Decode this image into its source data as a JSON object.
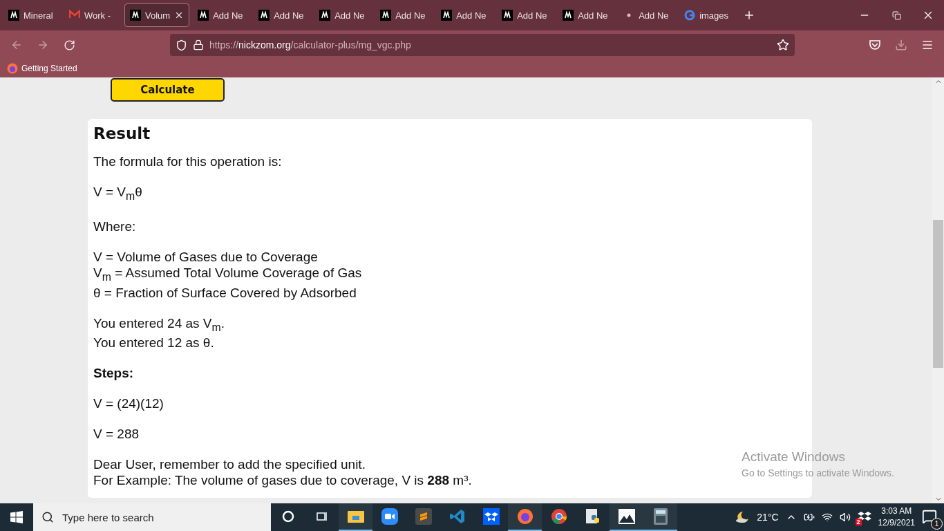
{
  "tabs": [
    {
      "label": "Mineral",
      "kind": "site",
      "selected": false
    },
    {
      "label": "Work -",
      "kind": "mail",
      "selected": false
    },
    {
      "label": "Volum",
      "kind": "site",
      "selected": true
    },
    {
      "label": "Add Ne",
      "kind": "site",
      "selected": false
    },
    {
      "label": "Add Ne",
      "kind": "site",
      "selected": false
    },
    {
      "label": "Add Ne",
      "kind": "site",
      "selected": false
    },
    {
      "label": "Add Ne",
      "kind": "site",
      "selected": false
    },
    {
      "label": "Add Ne",
      "kind": "site",
      "selected": false
    },
    {
      "label": "Add Ne",
      "kind": "site",
      "selected": false
    },
    {
      "label": "Add Ne",
      "kind": "site",
      "selected": false
    },
    {
      "label": "Add Ne",
      "kind": "loading",
      "selected": false
    },
    {
      "label": "images",
      "kind": "search",
      "selected": false
    }
  ],
  "address_bar": {
    "url_prefix": "https://",
    "url_domain": "nickzom.org",
    "url_path": "/calculator-plus/mg_vgc.php"
  },
  "bookmarks": [
    {
      "label": "Getting Started"
    }
  ],
  "page": {
    "calculate_button": "Calculate",
    "result": {
      "title": "Result",
      "blocks": [
        {
          "kind": "text",
          "lines": [
            "The formula for this operation is:"
          ]
        },
        {
          "kind": "text",
          "lines": [
            "V = V$_{m}$θ"
          ]
        },
        {
          "kind": "text",
          "lines": [
            "Where:"
          ]
        },
        {
          "kind": "text",
          "lines": [
            "V = Volume of Gases due to Coverage",
            "V$_{m}$ = Assumed Total Volume Coverage of Gas",
            "θ = Fraction of Surface Covered by Adsorbed"
          ]
        },
        {
          "kind": "text",
          "lines": [
            "You entered 24 as V$_{m}$.",
            "You entered 12 as θ."
          ]
        },
        {
          "kind": "heading",
          "lines": [
            "Steps:"
          ]
        },
        {
          "kind": "text",
          "lines": [
            "V = (24)(12)"
          ]
        },
        {
          "kind": "text",
          "lines": [
            "V = 288"
          ]
        },
        {
          "kind": "text",
          "lines": [
            "Dear User, remember to add the specified unit.",
            "For Example: The volume of gases due to coverage, V is **288** m³."
          ]
        }
      ]
    }
  },
  "activation_notice": {
    "title": "Activate Windows",
    "message": "Go to Settings to activate Windows."
  },
  "taskbar": {
    "search_placeholder": "Type here to search",
    "apps": [
      {
        "kind": "cortana",
        "running": false
      },
      {
        "kind": "taskview",
        "running": false
      },
      {
        "kind": "explorer",
        "running": true
      },
      {
        "kind": "zoom",
        "running": false
      },
      {
        "kind": "sublime",
        "running": false
      },
      {
        "kind": "vscode",
        "running": false
      },
      {
        "kind": "dropbox",
        "running": false
      },
      {
        "kind": "firefox",
        "running": true
      },
      {
        "kind": "chrome",
        "running": false
      },
      {
        "kind": "python",
        "running": false
      },
      {
        "kind": "photos",
        "running": true
      },
      {
        "kind": "calculator",
        "running": true
      }
    ],
    "temperature": "21°C",
    "dropbox_badge": "2",
    "time": "3:03 AM",
    "date": "12/9/2021",
    "notification_count": "1"
  }
}
